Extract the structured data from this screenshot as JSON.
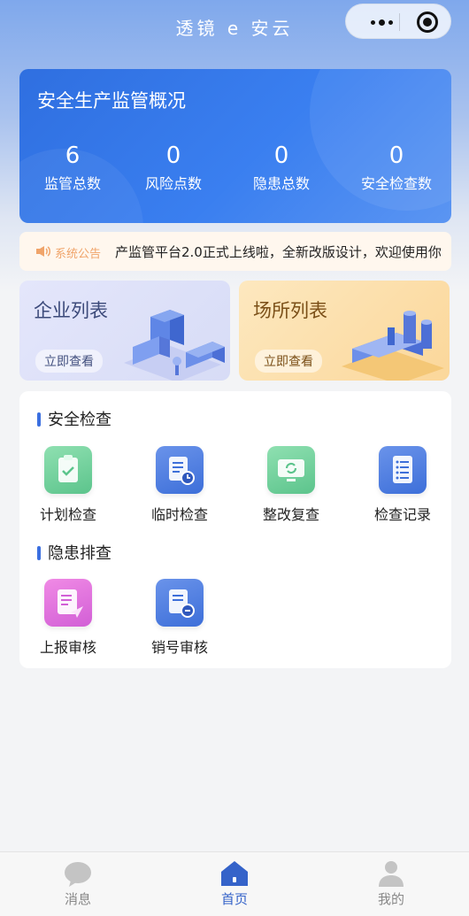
{
  "header": {
    "app_title": "透镜 e 安云"
  },
  "overview": {
    "title": "安全生产监管概况",
    "stats": [
      {
        "value": "6",
        "label": "监管总数"
      },
      {
        "value": "0",
        "label": "风险点数"
      },
      {
        "value": "0",
        "label": "隐患总数"
      },
      {
        "value": "0",
        "label": "安全检查数"
      }
    ]
  },
  "notice": {
    "tag": "系统公告",
    "text": "产监管平台2.0正式上线啦，全新改版设计，欢迎使用你"
  },
  "cards": {
    "enterprise": {
      "title": "企业列表",
      "button": "立即查看"
    },
    "venue": {
      "title": "场所列表",
      "button": "立即查看"
    }
  },
  "safety_check": {
    "title": "安全检查",
    "items": [
      {
        "label": "计划检查",
        "icon": "clipboard-check-icon"
      },
      {
        "label": "临时检查",
        "icon": "document-clock-icon"
      },
      {
        "label": "整改复查",
        "icon": "monitor-refresh-icon"
      },
      {
        "label": "检查记录",
        "icon": "list-document-icon"
      }
    ]
  },
  "hazard_check": {
    "title": "隐患排查",
    "items": [
      {
        "label": "上报审核",
        "icon": "document-send-icon"
      },
      {
        "label": "销号审核",
        "icon": "document-cancel-icon"
      }
    ]
  },
  "tabbar": {
    "items": [
      {
        "label": "消息",
        "icon": "chat-bubble-icon"
      },
      {
        "label": "首页",
        "icon": "home-icon"
      },
      {
        "label": "我的",
        "icon": "user-icon"
      }
    ],
    "active_color": "#3563c9",
    "inactive_color": "#888888"
  },
  "colors": {
    "primary": "#3a7ff0",
    "accent_bar": "#3b6fe0"
  }
}
